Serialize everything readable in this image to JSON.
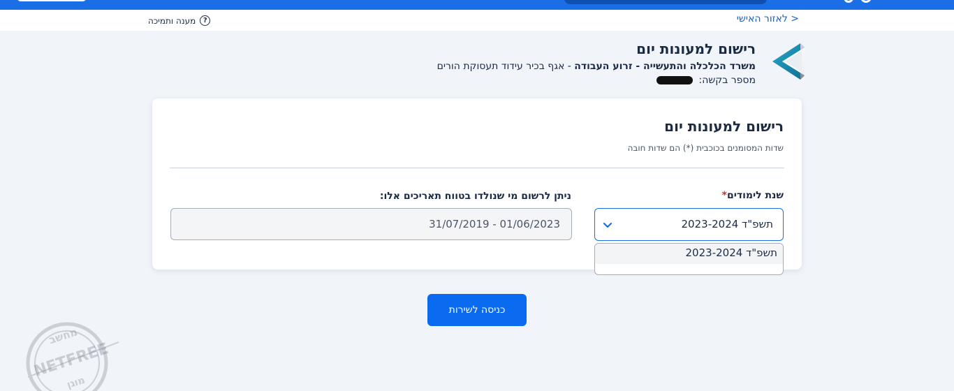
{
  "colors": {
    "brand_blue": "#1a6ee6",
    "button_blue": "#0b6bf0",
    "required_red": "#d32f2f",
    "page_background": "#f1f4f9"
  },
  "nav": {
    "back_link": "< לאזור האישי",
    "support_label": "מענה ותמיכה",
    "support_icon": "question-circle-icon"
  },
  "header": {
    "title": "רישום למעונות יום",
    "ministry_bold": "משרד הכלכלה והתעשייה - זרוע העבודה",
    "ministry_rest": " - אגף בכיר עידוד תעסוקת הורים",
    "request_label": "מספר בקשה:",
    "logo_icon": "triangle-logo-icon"
  },
  "form": {
    "title": "רישום למעונות יום",
    "required_note": "שדות המסומנים בכוכבית (*) הם שדות חובה",
    "year_label": "שנת לימודים",
    "required_mark": "*",
    "year_value": "תשפ\"ד 2023-2024",
    "year_options": [
      "תשפ\"ד 2023-2024"
    ],
    "range_label": "ניתן לרשום מי שנולדו בטווח תאריכים אלו:",
    "range_value": "01/06/2023 - 31/07/2019"
  },
  "actions": {
    "enter_button": "כניסה לשירות"
  },
  "watermark": {
    "line1": "מחשב",
    "line2": "NETFREE",
    "line3": "מוגן"
  }
}
